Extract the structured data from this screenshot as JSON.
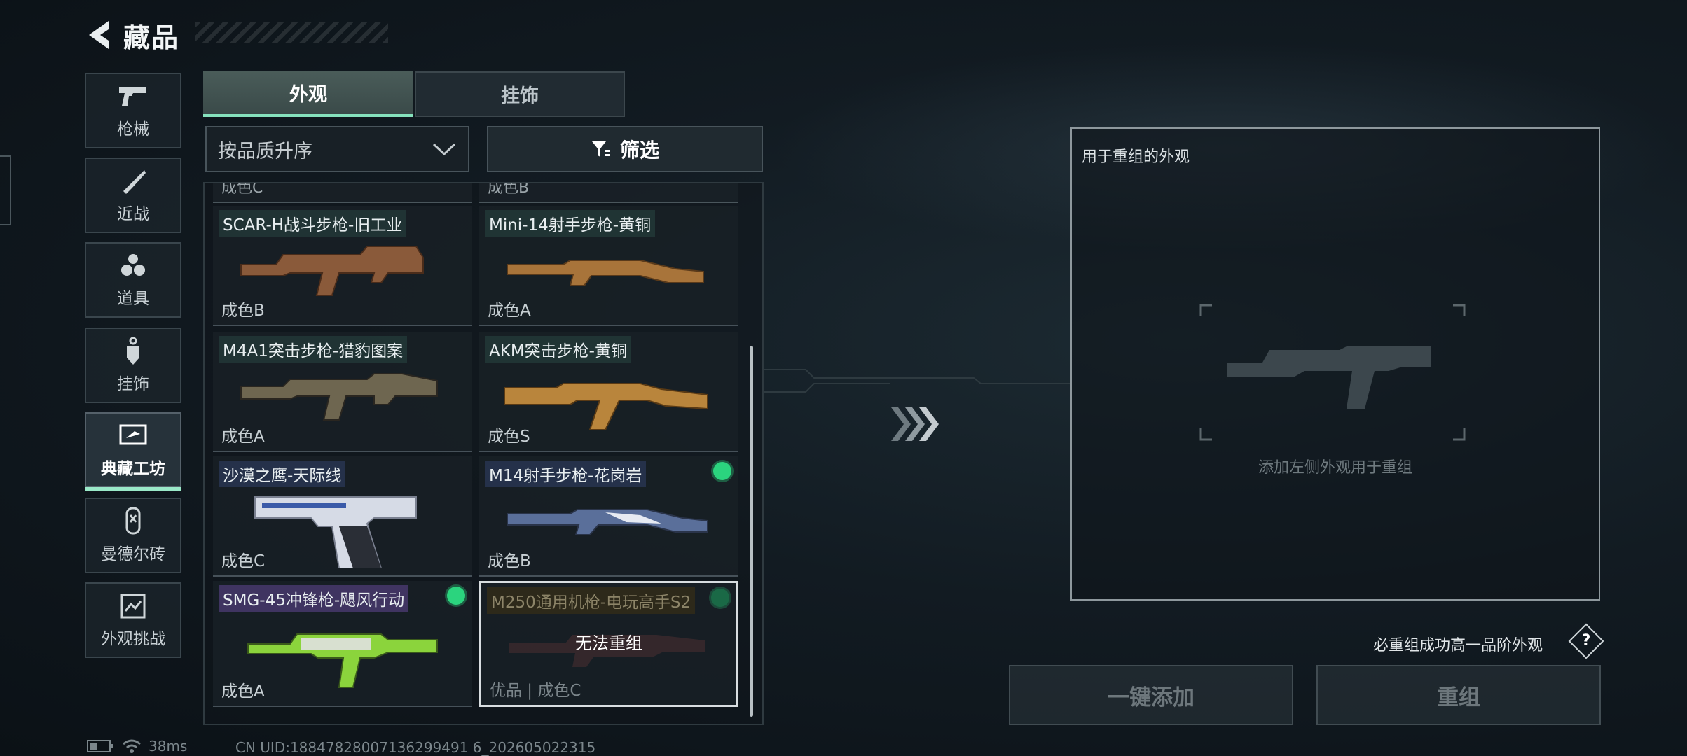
{
  "header": {
    "title": "藏品"
  },
  "nav": [
    {
      "label": "枪械",
      "icon": "pistol-icon"
    },
    {
      "label": "近战",
      "icon": "knife-icon"
    },
    {
      "label": "道具",
      "icon": "grenade-icon"
    },
    {
      "label": "挂饰",
      "icon": "charm-icon"
    },
    {
      "label": "典藏工坊",
      "icon": "workshop-icon",
      "active": true
    },
    {
      "label": "曼德尔砖",
      "icon": "mandel-brick-icon"
    },
    {
      "label": "外观挑战",
      "icon": "challenge-icon"
    }
  ],
  "tabs": {
    "skins": "外观",
    "charms": "挂饰"
  },
  "sort": {
    "value": "按品质升序"
  },
  "filter": {
    "label": "筛选"
  },
  "grid": {
    "stubs": [
      "成色C",
      "成色B"
    ],
    "cards": [
      {
        "name": "SCAR-H战斗步枪-旧工业",
        "grade": "成色B",
        "gun_color": "#8a5a3a"
      },
      {
        "name": "Mini-14射手步枪-黄铜",
        "grade": "成色A",
        "gun_color": "#a8743a"
      },
      {
        "name": "M4A1突击步枪-猎豹图案",
        "grade": "成色A",
        "gun_color": "#6e6650"
      },
      {
        "name": "AKM突击步枪-黄铜",
        "grade": "成色S",
        "gun_color": "#b9853c"
      },
      {
        "name": "沙漠之鹰-天际线",
        "grade": "成色C",
        "gun_color": "#d6dbe6"
      },
      {
        "name": "M14射手步枪-花岗岩",
        "grade": "成色B",
        "gun_color": "#5a6f9a",
        "dot": true
      },
      {
        "name": "SMG-45冲锋枪-飓风行动",
        "grade": "成色A",
        "gun_color": "#8bd43c",
        "dot": true
      },
      {
        "name": "M250通用机枪-电玩高手S2",
        "grade": "优品 | 成色C",
        "overlay": "无法重组",
        "gun_color": "#6a3a3a",
        "dot": true
      }
    ]
  },
  "recombine": {
    "panel_title": "用于重组的外观",
    "slot_hint": "添加左侧外观用于重组",
    "guarantee": "必重组成功高一品阶外观",
    "help": "?",
    "add_button": "一键添加",
    "recombine_button": "重组"
  },
  "status": {
    "ping": "38ms",
    "uid": "CN UID:18847828007136299491 6_202605022315"
  }
}
